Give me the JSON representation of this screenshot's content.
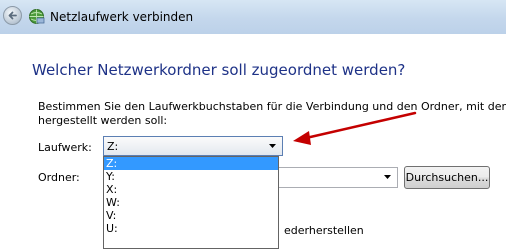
{
  "window": {
    "title": "Netzlaufwerk verbinden"
  },
  "page": {
    "heading": "Welcher Netzwerkordner soll zugeordnet werden?",
    "description_line1": "Bestimmen Sie den Laufwerkbuchstaben für die Verbindung und den Ordner, mit dem di",
    "description_line2": "hergestellt werden soll:"
  },
  "drive": {
    "label": "Laufwerk:",
    "selected": "Z:",
    "options": [
      "Z:",
      "Y:",
      "X:",
      "W:",
      "V:",
      "U:"
    ]
  },
  "folder": {
    "label": "Ordner:",
    "browse_label": "Durchsuchen..."
  },
  "reconnect": {
    "visible_text": "ederherstellen"
  },
  "colors": {
    "heading": "#1e3287",
    "selection": "#3399ff",
    "annotation_arrow": "#c40000"
  }
}
